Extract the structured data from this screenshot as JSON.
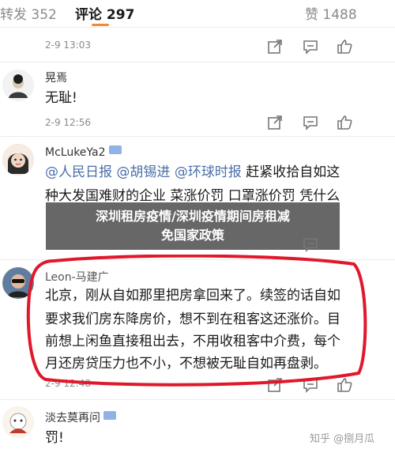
{
  "tabs": {
    "repost": "转发 352",
    "comment": "评论 297",
    "like": "赞 1488"
  },
  "comments": [
    {
      "id": "c0",
      "meta": "2-9 13:03"
    },
    {
      "id": "c1",
      "user": "晃焉",
      "text": "无耻!",
      "meta": "2-9 12:56"
    },
    {
      "id": "c2",
      "user": "McLukeYa2",
      "line1": {
        "m1": "@人民日报",
        "m2": "@胡锡进",
        "m3": "@环球时报",
        "rest": "赶紧收拾自如这"
      },
      "line2": "种大发国难财的企业 菜涨价罚 口罩涨价罚 凭什么"
    },
    {
      "id": "c3",
      "user": "Leon-马建广",
      "lines": [
        "北京，刚从自如那里把房拿回来了。续签的话自如",
        "要求我们房东降房价，想不到在租客这还涨价。目",
        "前想上闲鱼直接租出去，不用收租客中介费，每个",
        "月还房贷压力也不小，不想被无耻自如再盘剥。"
      ],
      "meta": "2-9 12:48"
    },
    {
      "id": "c4",
      "user": "淡去莫再问",
      "text": "罚!"
    }
  ],
  "banner": {
    "line1": "深圳租房疫情/深圳疫情期间房租减",
    "line2": "免国家政策"
  },
  "watermark": "知乎 @捌月瓜",
  "colors": {
    "accent": "#f08a2a",
    "link": "#4a6ea8",
    "highlight_circle": "#e0182b"
  },
  "icons": [
    "share-icon",
    "reply-icon",
    "like-icon",
    "verified-badge-icon"
  ]
}
